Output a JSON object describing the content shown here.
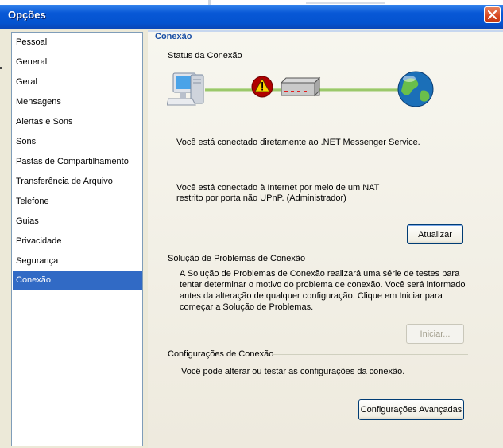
{
  "window": {
    "title": "Opções"
  },
  "sidebar": {
    "items": [
      {
        "label": "Pessoal"
      },
      {
        "label": "General"
      },
      {
        "label": "Geral"
      },
      {
        "label": "Mensagens"
      },
      {
        "label": "Alertas e Sons"
      },
      {
        "label": "Sons"
      },
      {
        "label": "Pastas de Compartilhamento"
      },
      {
        "label": "Transferência de Arquivo"
      },
      {
        "label": "Telefone"
      },
      {
        "label": "Guias"
      },
      {
        "label": "Privacidade"
      },
      {
        "label": "Segurança"
      },
      {
        "label": "Conexão",
        "selected": true
      }
    ]
  },
  "panel": {
    "header": "Conexão",
    "status": {
      "title": "Status da Conexão",
      "line1": "Você está conectado diretamente ao .NET Messenger Service.",
      "line2a": "Você está conectado à Internet por meio de um  NAT",
      "line2b": "restrito por porta não UPnP.  (Administrador)",
      "refresh_button": "Atualizar"
    },
    "troubleshoot": {
      "title": "Solução de Problemas de Conexão",
      "desc1": "A Solução de Problemas de Conexão realizará uma série de testes para",
      "desc2": "tentar determinar o motivo do problema de conexão. Você será informado",
      "desc3": "antes da alteração de qualquer configuração. Clique em Iniciar para",
      "desc4": "começar a Solução de Problemas.",
      "start_button": "Iniciar..."
    },
    "settings": {
      "title": "Configurações de Conexão",
      "desc": "Você pode alterar ou testar as configurações da conexão.",
      "advanced_button": "Configurações Avançadas"
    }
  },
  "colors": {
    "accent": "#316ac5",
    "titlebar": "#0858d6",
    "warning": "#c00000",
    "link_line": "#8cc63f"
  },
  "icons": [
    "computer-icon",
    "warning-icon",
    "router-icon",
    "globe-icon",
    "close-icon"
  ]
}
